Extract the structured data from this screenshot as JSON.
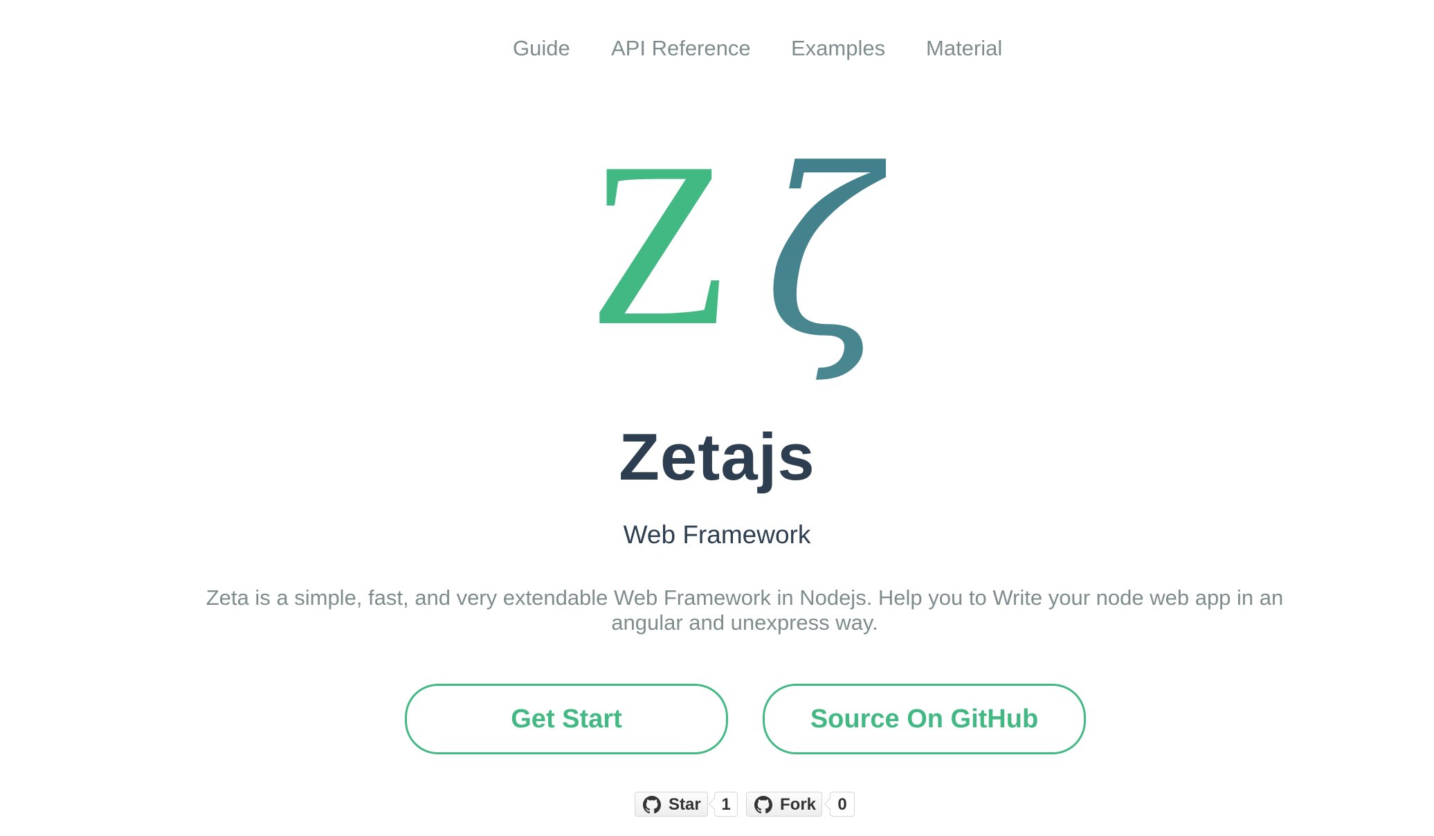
{
  "nav": {
    "items": [
      {
        "label": "Guide"
      },
      {
        "label": "API Reference"
      },
      {
        "label": "Examples"
      },
      {
        "label": "Material"
      }
    ]
  },
  "logo": {
    "latin": "Z",
    "greek": "ζ",
    "colors": {
      "latin": "#42b983",
      "greek_top": "#3f7f8b",
      "greek_bottom": "#4a8790"
    }
  },
  "hero": {
    "title": "Zetajs",
    "subtitle": "Web Framework",
    "description": "Zeta is a simple, fast, and very extendable Web Framework in Nodejs. Help you to Write your node web app in an angular and unexpress way."
  },
  "buttons": {
    "start_label": "Get Start",
    "github_label": "Source On GitHub"
  },
  "github": {
    "star_label": "Star",
    "star_count": "1",
    "fork_label": "Fork",
    "fork_count": "0",
    "icon": "github-octocat-icon"
  },
  "colors": {
    "accent": "#42b983",
    "heading": "#2c3e50",
    "muted": "#7f8c8d"
  }
}
